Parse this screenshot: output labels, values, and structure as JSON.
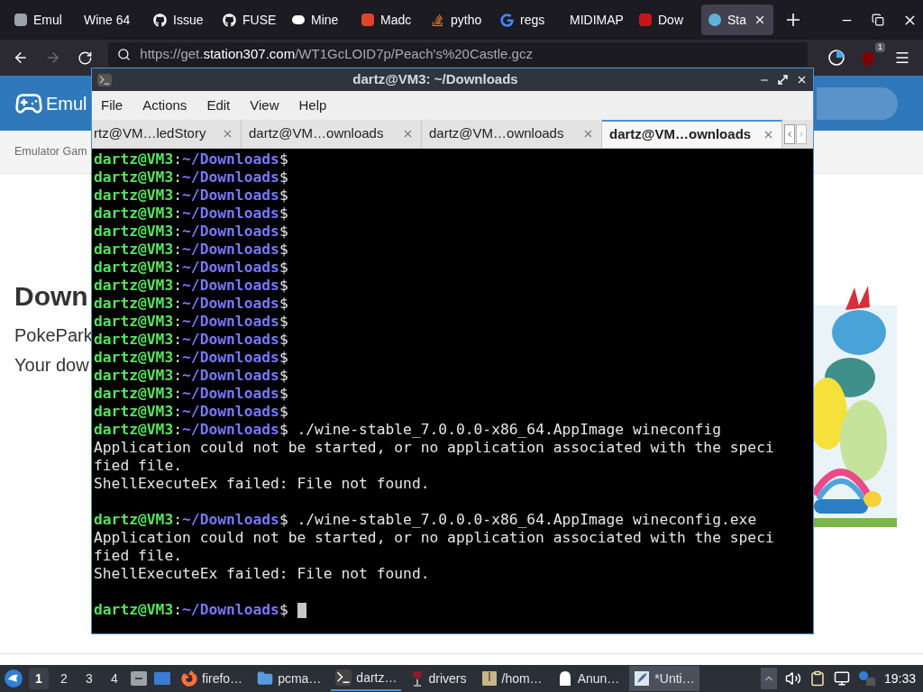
{
  "browser": {
    "tabs": [
      {
        "title": "Emul",
        "selected": false
      },
      {
        "title": "Wine 64",
        "selected": false
      },
      {
        "title": "Issue",
        "selected": false
      },
      {
        "title": "FUSE",
        "selected": false
      },
      {
        "title": "Mine",
        "selected": false
      },
      {
        "title": "Madc",
        "selected": false
      },
      {
        "title": "pytho",
        "selected": false
      },
      {
        "title": "regs",
        "selected": false
      },
      {
        "title": "MIDIMAP",
        "selected": false
      },
      {
        "title": "Dow",
        "selected": false
      },
      {
        "title": "Sta",
        "selected": true
      }
    ],
    "url": {
      "prefix": "https://get.",
      "domain": "station307.com",
      "path": "/WT1GcLOID7p/Peach's%20Castle.gcz"
    },
    "extension_badge": "1"
  },
  "page": {
    "logo_text": "Emul",
    "breadcrumb": "Emulator Gam",
    "heading": "Down",
    "lines": [
      "PokePark",
      "Your dow"
    ]
  },
  "terminal": {
    "title": "dartz@VM3: ~/Downloads",
    "menu": [
      "File",
      "Actions",
      "Edit",
      "View",
      "Help"
    ],
    "tabs": [
      {
        "label": "rtz@VM…ledStory",
        "selected": false
      },
      {
        "label": "dartz@VM…ownloads",
        "selected": false
      },
      {
        "label": "dartz@VM…ownloads",
        "selected": false
      },
      {
        "label": "dartz@VM…ownloads",
        "selected": true
      }
    ],
    "lines": [
      {
        "kind": "prompt",
        "user": "dartz@VM3",
        "sep": ":",
        "path": "~/Downloads",
        "symbol": "$"
      },
      {
        "kind": "prompt",
        "user": "dartz@VM3",
        "sep": ":",
        "path": "~/Downloads",
        "symbol": "$"
      },
      {
        "kind": "prompt",
        "user": "dartz@VM3",
        "sep": ":",
        "path": "~/Downloads",
        "symbol": "$"
      },
      {
        "kind": "prompt",
        "user": "dartz@VM3",
        "sep": ":",
        "path": "~/Downloads",
        "symbol": "$"
      },
      {
        "kind": "prompt",
        "user": "dartz@VM3",
        "sep": ":",
        "path": "~/Downloads",
        "symbol": "$"
      },
      {
        "kind": "prompt",
        "user": "dartz@VM3",
        "sep": ":",
        "path": "~/Downloads",
        "symbol": "$"
      },
      {
        "kind": "prompt",
        "user": "dartz@VM3",
        "sep": ":",
        "path": "~/Downloads",
        "symbol": "$"
      },
      {
        "kind": "prompt",
        "user": "dartz@VM3",
        "sep": ":",
        "path": "~/Downloads",
        "symbol": "$"
      },
      {
        "kind": "prompt",
        "user": "dartz@VM3",
        "sep": ":",
        "path": "~/Downloads",
        "symbol": "$"
      },
      {
        "kind": "prompt",
        "user": "dartz@VM3",
        "sep": ":",
        "path": "~/Downloads",
        "symbol": "$"
      },
      {
        "kind": "prompt",
        "user": "dartz@VM3",
        "sep": ":",
        "path": "~/Downloads",
        "symbol": "$"
      },
      {
        "kind": "prompt",
        "user": "dartz@VM3",
        "sep": ":",
        "path": "~/Downloads",
        "symbol": "$"
      },
      {
        "kind": "prompt",
        "user": "dartz@VM3",
        "sep": ":",
        "path": "~/Downloads",
        "symbol": "$"
      },
      {
        "kind": "prompt",
        "user": "dartz@VM3",
        "sep": ":",
        "path": "~/Downloads",
        "symbol": "$"
      },
      {
        "kind": "prompt",
        "user": "dartz@VM3",
        "sep": ":",
        "path": "~/Downloads",
        "symbol": "$"
      },
      {
        "kind": "prompt",
        "user": "dartz@VM3",
        "sep": ":",
        "path": "~/Downloads",
        "symbol": "$",
        "command": "./wine-stable_7.0.0.0-x86_64.AppImage wineconfig"
      },
      {
        "kind": "output",
        "text": "Application could not be started, or no application associated with the speci"
      },
      {
        "kind": "output",
        "text": "fied file."
      },
      {
        "kind": "output",
        "text": "ShellExecuteEx failed: File not found."
      },
      {
        "kind": "blank"
      },
      {
        "kind": "prompt",
        "user": "dartz@VM3",
        "sep": ":",
        "path": "~/Downloads",
        "symbol": "$",
        "command": "./wine-stable_7.0.0.0-x86_64.AppImage wineconfig.exe"
      },
      {
        "kind": "output",
        "text": "Application could not be started, or no application associated with the speci"
      },
      {
        "kind": "output",
        "text": "fied file."
      },
      {
        "kind": "output",
        "text": "ShellExecuteEx failed: File not found."
      },
      {
        "kind": "blank"
      },
      {
        "kind": "prompt",
        "user": "dartz@VM3",
        "sep": ":",
        "path": "~/Downloads",
        "symbol": "$",
        "cursor": true
      }
    ]
  },
  "taskbar": {
    "workspaces": [
      {
        "label": "1",
        "selected": true
      },
      {
        "label": "2",
        "selected": false
      },
      {
        "label": "3",
        "selected": false
      },
      {
        "label": "4",
        "selected": false
      }
    ],
    "tasks": [
      {
        "label": "firefo…",
        "selected": false,
        "highlighted": false
      },
      {
        "label": "pcma…",
        "selected": false,
        "highlighted": false
      },
      {
        "label": "dartz…",
        "selected": true,
        "highlighted": false
      },
      {
        "label": "drivers",
        "selected": false,
        "highlighted": false
      },
      {
        "label": "/hom…",
        "selected": false,
        "highlighted": false
      },
      {
        "label": "Anun…",
        "selected": false,
        "highlighted": false
      },
      {
        "label": "*Unti…",
        "selected": false,
        "highlighted": true
      }
    ],
    "clock": "19:33"
  }
}
